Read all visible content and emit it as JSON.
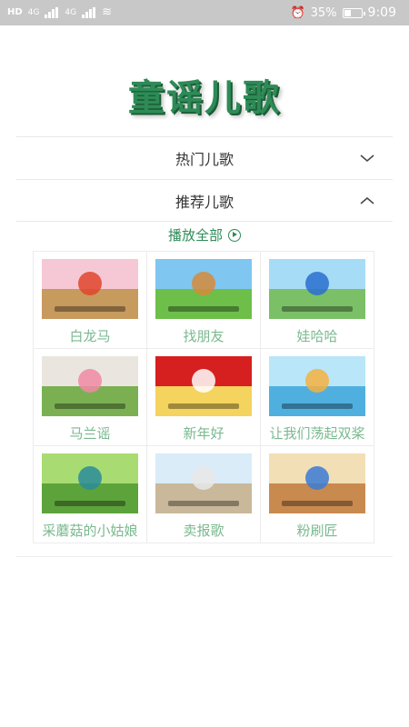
{
  "status_bar": {
    "left_indicators": "HD",
    "network1": "4G",
    "network2": "4G",
    "battery": "35%",
    "time": "9:09"
  },
  "app": {
    "title": "童谣儿歌"
  },
  "sections": [
    {
      "label": "热门儿歌",
      "expanded": false,
      "icon": "chevron-down-icon"
    },
    {
      "label": "推荐儿歌",
      "expanded": true,
      "icon": "chevron-up-icon"
    }
  ],
  "play_all": {
    "label": "播放全部",
    "icon": "play-circle-icon"
  },
  "songs": [
    {
      "title": "白龙马",
      "colors": [
        "#f6c8d6",
        "#c79a5e",
        "#e0452c"
      ]
    },
    {
      "title": "找朋友",
      "colors": [
        "#7fc6f0",
        "#6dbf4a",
        "#d68a3b"
      ]
    },
    {
      "title": "娃哈哈",
      "colors": [
        "#a7dcf7",
        "#7bc067",
        "#2a6fcf"
      ]
    },
    {
      "title": "马兰谣",
      "colors": [
        "#eae6df",
        "#7ab052",
        "#f08aa4"
      ]
    },
    {
      "title": "新年好",
      "colors": [
        "#d62020",
        "#f4d35e",
        "#ffffff"
      ]
    },
    {
      "title": "让我们荡起双桨",
      "colors": [
        "#b9e6f8",
        "#4fb0e0",
        "#f5b041"
      ]
    },
    {
      "title": "采蘑菇的小姑娘",
      "colors": [
        "#a8dc72",
        "#5da33b",
        "#2a8c9a"
      ]
    },
    {
      "title": "卖报歌",
      "colors": [
        "#d9ecf7",
        "#c9b89a",
        "#e7e7e7"
      ]
    },
    {
      "title": "粉刷匠",
      "colors": [
        "#f3dfb5",
        "#c98a4f",
        "#3a7bd5"
      ]
    }
  ]
}
